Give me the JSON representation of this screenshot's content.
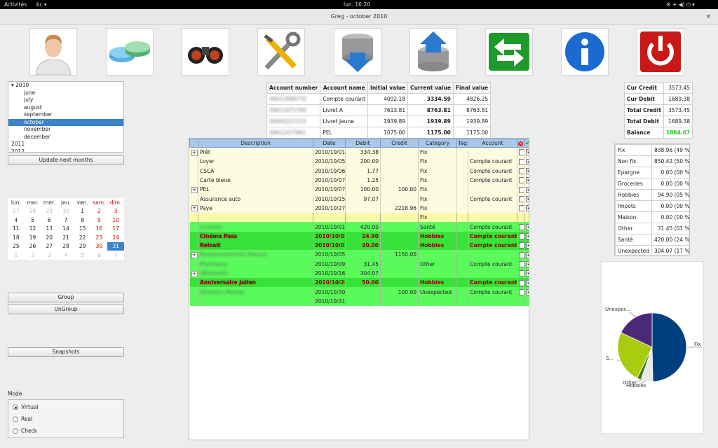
{
  "topbar": {
    "activities": "Activités",
    "app": "kc ▾",
    "clock": "lun. 16:20",
    "sys_icons": "⚙ ✈ ◀) ⏻ ▾"
  },
  "window": {
    "title": "Greg - october 2010",
    "close": "×"
  },
  "toolbar": [
    {
      "name": "user-icon"
    },
    {
      "name": "accounts-pie-icon"
    },
    {
      "name": "binoculars-search-icon"
    },
    {
      "name": "tools-icon"
    },
    {
      "name": "db-import-icon"
    },
    {
      "name": "db-export-icon"
    },
    {
      "name": "transfer-icon"
    },
    {
      "name": "info-icon"
    },
    {
      "name": "power-icon"
    }
  ],
  "months_tree": {
    "items": [
      {
        "label": "▾ 2010",
        "indent": 0,
        "sel": false
      },
      {
        "label": "june",
        "indent": 1,
        "sel": false
      },
      {
        "label": "july",
        "indent": 1,
        "sel": false
      },
      {
        "label": "august",
        "indent": 1,
        "sel": false
      },
      {
        "label": "september",
        "indent": 1,
        "sel": false
      },
      {
        "label": "october",
        "indent": 1,
        "sel": true
      },
      {
        "label": "november",
        "indent": 1,
        "sel": false
      },
      {
        "label": "december",
        "indent": 1,
        "sel": false
      },
      {
        "label": "2011",
        "indent": 0,
        "sel": false
      },
      {
        "label": "2012",
        "indent": 0,
        "sel": false
      }
    ],
    "update_button": "Update next months"
  },
  "calendar": {
    "weekdays": [
      "lun.",
      "mar.",
      "mer.",
      "jeu.",
      "ven.",
      "sam.",
      "dim."
    ],
    "weeks": [
      [
        "27",
        "28",
        "29",
        "30",
        "1",
        "2",
        "3"
      ],
      [
        "4",
        "5",
        "6",
        "7",
        "8",
        "9",
        "10"
      ],
      [
        "11",
        "12",
        "13",
        "14",
        "15",
        "16",
        "17"
      ],
      [
        "18",
        "19",
        "20",
        "21",
        "22",
        "23",
        "24"
      ],
      [
        "25",
        "26",
        "27",
        "28",
        "29",
        "30",
        "31"
      ],
      [
        "1",
        "2",
        "3",
        "4",
        "5",
        "6",
        "7"
      ]
    ]
  },
  "buttons": {
    "group": "Group",
    "ungroup": "UnGroup",
    "snapshots": "Snapshots"
  },
  "mode": {
    "label": "Mode",
    "options": [
      {
        "label": "Virtual",
        "on": true
      },
      {
        "label": "Real",
        "on": false
      },
      {
        "label": "Check",
        "on": false
      }
    ]
  },
  "accounts": {
    "headers": [
      "Account number",
      "Account name",
      "Initial value",
      "Current value",
      "Final value"
    ],
    "rows": [
      {
        "number": "00612996770",
        "name": "Compte courant",
        "initial": "4092.18",
        "current": "3334.59",
        "final": "4826.25"
      },
      {
        "number": "00612471784",
        "name": "Livret A",
        "initial": "7613.81",
        "current": "8763.81",
        "final": "8763.81"
      },
      {
        "number": "00693257233",
        "name": "Livret Jeune",
        "initial": "1939.89",
        "current": "1939.89",
        "final": "1939.89"
      },
      {
        "number": "00612477961",
        "name": "PEL",
        "initial": "1075.00",
        "current": "1175.00",
        "final": "1175.00"
      }
    ]
  },
  "summary": {
    "rows": [
      {
        "label": "Cur Credit",
        "value": "3573.45",
        "green": false
      },
      {
        "label": "Cur Debit",
        "value": "1689.38",
        "green": false
      },
      {
        "label": "Total Credit",
        "value": "3573.45",
        "green": false
      },
      {
        "label": "Total Debit",
        "value": "1689.38",
        "green": false
      },
      {
        "label": "Balance",
        "value": "1884.07",
        "green": true
      }
    ]
  },
  "categories": {
    "rows": [
      {
        "label": "Fix",
        "value": "838.96 (49 %)"
      },
      {
        "label": "Non fix",
        "value": "850.42 (50 %)"
      },
      {
        "label": "Epargne",
        "value": "0.00 (00 %)"
      },
      {
        "label": "Groceries",
        "value": "0.00 (00 %)"
      },
      {
        "label": "Hobbies",
        "value": "94.90 (05 %)"
      },
      {
        "label": "Impots",
        "value": "0.00 (00 %)"
      },
      {
        "label": "Maison",
        "value": "0.00 (00 %)"
      },
      {
        "label": "Other",
        "value": "31.45 (01 %)"
      },
      {
        "label": "Santé",
        "value": "420.00 (24 %)"
      },
      {
        "label": "Unexpected",
        "value": "304.07 (17 %)"
      }
    ]
  },
  "pie": {
    "slices": [
      {
        "label": "Fix",
        "value": 838.96,
        "color": "#003f7f"
      },
      {
        "label": "Hobbies",
        "value": 94.9,
        "color": "#e8e8e8"
      },
      {
        "label": "Other",
        "value": 31.45,
        "color": "#3a7a10"
      },
      {
        "label": "Santé",
        "value": 420.0,
        "color": "#a8cc10"
      },
      {
        "label": "Unexpected",
        "value": 304.07,
        "color": "#4a2a78"
      }
    ],
    "labels": {
      "fix": "Fix",
      "hobbies": "Hobbies",
      "other": "Other",
      "sante": "S...",
      "unexpected": "Unexpec..."
    }
  },
  "operations": {
    "headers": [
      "Description",
      "Date",
      "Debit",
      "Credit",
      "Category",
      "Tag",
      "Account"
    ],
    "rows": [
      {
        "style": "y",
        "exp": "+",
        "desc": "Prêt",
        "blur": false,
        "date": "2010/10/01",
        "debit": "334.38",
        "credit": "",
        "cat": "Fix",
        "tag": "",
        "account": "",
        "c1": false,
        "c2": true
      },
      {
        "style": "y",
        "exp": "",
        "desc": "Loyer",
        "blur": false,
        "date": "2010/10/05",
        "debit": "200.00",
        "credit": "",
        "cat": "Fix",
        "tag": "",
        "account": "Compte courant",
        "c1": false,
        "c2": true
      },
      {
        "style": "y",
        "exp": "",
        "desc": "CSCA",
        "blur": false,
        "date": "2010/10/06",
        "debit": "1.77",
        "credit": "",
        "cat": "Fix",
        "tag": "",
        "account": "Compte courant",
        "c1": false,
        "c2": true
      },
      {
        "style": "y",
        "exp": "",
        "desc": "Carte bleue",
        "blur": false,
        "date": "2010/10/07",
        "debit": "1.25",
        "credit": "",
        "cat": "Fix",
        "tag": "",
        "account": "Compte courant",
        "c1": false,
        "c2": true
      },
      {
        "style": "y",
        "exp": "+",
        "desc": "PEL",
        "blur": false,
        "date": "2010/10/07",
        "debit": "100.00",
        "credit": "100.00",
        "cat": "Fix",
        "tag": "",
        "account": "",
        "c1": false,
        "c2": true
      },
      {
        "style": "y",
        "exp": "",
        "desc": "Assurance auto",
        "blur": false,
        "date": "2010/10/15",
        "debit": "97.07",
        "credit": "",
        "cat": "Fix",
        "tag": "",
        "account": "Compte courant",
        "c1": false,
        "c2": true
      },
      {
        "style": "y",
        "exp": "+",
        "desc": "Paye",
        "blur": false,
        "date": "2010/10/27",
        "debit": "",
        "credit": "2218.96",
        "cat": "Fix",
        "tag": "",
        "account": "",
        "c1": false,
        "c2": true
      },
      {
        "style": "ysel",
        "exp": "",
        "desc": "",
        "blur": false,
        "date": "",
        "debit": "",
        "credit": "",
        "cat": "Fix",
        "tag": "",
        "account": "",
        "c1": null,
        "c2": null
      },
      {
        "style": "g",
        "exp": "",
        "desc": "Lunettes",
        "blur": true,
        "date": "2010/10/01",
        "debit": "420.00",
        "credit": "",
        "cat": "Santé",
        "tag": "",
        "account": "Compte courant",
        "c1": false,
        "c2": true
      },
      {
        "style": "gd bold",
        "exp": "",
        "desc": "Cinéma Pass",
        "blur": true,
        "date": "2010/10/02",
        "debit": "24.90",
        "credit": "",
        "cat": "Hobbies",
        "tag": "",
        "account": "Compte courant",
        "c1": false,
        "c2": true
      },
      {
        "style": "gd bold",
        "exp": "",
        "desc": "Retrait",
        "blur": true,
        "date": "2010/10/02",
        "debit": "20.00",
        "credit": "",
        "cat": "Hobbies",
        "tag": "",
        "account": "Compte courant",
        "c1": false,
        "c2": true
      },
      {
        "style": "g",
        "exp": "+",
        "desc": "Remboursements Maman",
        "blur": true,
        "date": "2010/10/05",
        "debit": "",
        "credit": "1150.00",
        "cat": "",
        "tag": "",
        "account": "",
        "c1": false,
        "c2": true
      },
      {
        "style": "g",
        "exp": "",
        "desc": "Pharmacie",
        "blur": true,
        "date": "2010/10/09",
        "debit": "31.45",
        "credit": "",
        "cat": "Other",
        "tag": "",
        "account": "Compte courant",
        "c1": false,
        "c2": true
      },
      {
        "style": "g",
        "exp": "+",
        "desc": "Vêtements",
        "blur": true,
        "date": "2010/10/16",
        "debit": "304.07",
        "credit": "",
        "cat": "",
        "tag": "",
        "account": "",
        "c1": false,
        "c2": true
      },
      {
        "style": "gd bold",
        "exp": "",
        "desc": "Anniversaire Julien",
        "blur": true,
        "date": "2010/10/28",
        "debit": "50.00",
        "credit": "",
        "cat": "Hobbies",
        "tag": "",
        "account": "Compte courant",
        "c1": false,
        "c2": true
      },
      {
        "style": "g",
        "exp": "",
        "desc": "Virement Maman",
        "blur": true,
        "date": "2010/10/30",
        "debit": "",
        "credit": "100.00",
        "cat": "Unexpected",
        "tag": "",
        "account": "Compte courant",
        "c1": false,
        "c2": true
      },
      {
        "style": "g",
        "exp": "",
        "desc": "",
        "blur": false,
        "date": "2010/10/31",
        "debit": "",
        "credit": "",
        "cat": "",
        "tag": "",
        "account": "",
        "c1": null,
        "c2": null
      }
    ]
  }
}
